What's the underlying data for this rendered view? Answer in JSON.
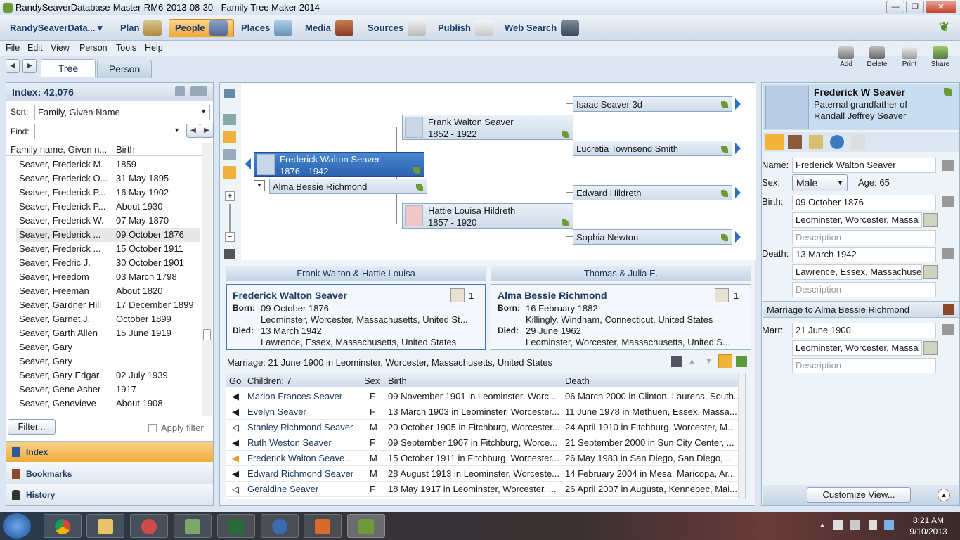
{
  "window": {
    "title": "RandySeaverDatabase-Master-RM6-2013-08-30 - Family Tree Maker 2014",
    "min": "—",
    "max": "❐",
    "close": "✕"
  },
  "nav": {
    "tree_name": "RandySeaverData... ▾",
    "items": [
      "Plan",
      "People",
      "Places",
      "Media",
      "Sources",
      "Publish",
      "Web Search"
    ]
  },
  "menu": [
    "File",
    "Edit",
    "View",
    "Person",
    "Tools",
    "Help"
  ],
  "tabs": {
    "tree": "Tree",
    "person": "Person"
  },
  "toolbar": {
    "add": "Add",
    "delete": "Delete",
    "print": "Print",
    "share": "Share"
  },
  "index": {
    "title": "Index: 42,076",
    "sort_label": "Sort:",
    "sort_value": "Family, Given Name",
    "find_label": "Find:",
    "col_name": "Family name, Given n...",
    "col_birth": "Birth",
    "rows": [
      {
        "name": "Seaver, Frederick M.",
        "birth": "1859"
      },
      {
        "name": "Seaver, Frederick O...",
        "birth": "31 May 1895"
      },
      {
        "name": "Seaver, Frederick P...",
        "birth": "16 May 1902"
      },
      {
        "name": "Seaver, Frederick P...",
        "birth": "About 1930"
      },
      {
        "name": "Seaver, Frederick W.",
        "birth": "07 May 1870"
      },
      {
        "name": "Seaver, Frederick ...",
        "birth": "09 October 1876"
      },
      {
        "name": "Seaver, Frederick ...",
        "birth": "15 October 1911"
      },
      {
        "name": "Seaver, Fredric J.",
        "birth": "30 October 1901"
      },
      {
        "name": "Seaver, Freedom",
        "birth": "03 March 1798"
      },
      {
        "name": "Seaver, Freeman",
        "birth": "About 1820"
      },
      {
        "name": "Seaver, Gardner Hill",
        "birth": "17 December 1899"
      },
      {
        "name": "Seaver, Garnet J.",
        "birth": "October 1899"
      },
      {
        "name": "Seaver, Garth Allen",
        "birth": "15 June 1919"
      },
      {
        "name": "Seaver, Gary",
        "birth": ""
      },
      {
        "name": "Seaver, Gary",
        "birth": ""
      },
      {
        "name": "Seaver, Gary Edgar",
        "birth": "02 July 1939"
      },
      {
        "name": "Seaver, Gene Asher",
        "birth": "1917"
      },
      {
        "name": "Seaver, Genevieve",
        "birth": "About 1908"
      }
    ],
    "filter_btn": "Filter...",
    "apply_filter": "Apply filter"
  },
  "sidebar": [
    "Index",
    "Bookmarks",
    "History"
  ],
  "tree": {
    "root": {
      "name": "Frederick Walton Seaver",
      "dates": "1876 - 1942"
    },
    "spouse": "Alma Bessie Richmond",
    "father": {
      "name": "Frank Walton Seaver",
      "dates": "1852 - 1922"
    },
    "mother": {
      "name": "Hattie Louisa Hildreth",
      "dates": "1857 - 1920"
    },
    "gf1": "Isaac Seaver 3d",
    "gm1": "Lucretia Townsend Smith",
    "gf2": "Edward Hildreth",
    "gm2": "Sophia Newton"
  },
  "family": {
    "parents_left": "Frank Walton & Hattie Louisa",
    "parents_right": "Thomas & Julia E.",
    "husband": {
      "name": "Frederick Walton Seaver",
      "born_label": "Born:",
      "born_date": "09 October 1876",
      "born_place": "Leominster, Worcester, Massachusetts, United St...",
      "died_label": "Died:",
      "died_date": "13 March 1942",
      "died_place": "Lawrence, Essex, Massachusetts, United States",
      "count": "1"
    },
    "wife": {
      "name": "Alma Bessie Richmond",
      "born_label": "Born:",
      "born_date": "16 February 1882",
      "born_place": "Killingly, Windham, Connecticut, United States",
      "died_label": "Died:",
      "died_date": "29 June 1962",
      "died_place": "Leominster, Worcester, Massachusetts, United S...",
      "count": "1"
    },
    "marriage_label": "Marriage:",
    "marriage": "21 June 1900 in Leominster, Worcester, Massachusetts, United States"
  },
  "children": {
    "headers": [
      "Go",
      "Children: 7",
      "Sex",
      "Birth",
      "Death"
    ],
    "rows": [
      {
        "go": "◀",
        "name": "Marion Frances Seaver",
        "sex": "F",
        "birth": "09 November 1901 in Leominster, Worc...",
        "death": "06 March 2000 in Clinton, Laurens, South..."
      },
      {
        "go": "◀",
        "name": "Evelyn Seaver",
        "sex": "F",
        "birth": "13 March 1903 in Leominster, Worcester...",
        "death": "11 June 1978 in Methuen, Essex, Massa..."
      },
      {
        "go": "◁",
        "name": "Stanley Richmond Seaver",
        "sex": "M",
        "birth": "20 October 1905 in Fitchburg, Worcester...",
        "death": "24 April 1910 in Fitchburg, Worcester, M..."
      },
      {
        "go": "◀",
        "name": "Ruth Weston Seaver",
        "sex": "F",
        "birth": "09 September 1907 in Fitchburg, Worce...",
        "death": "21 September 2000 in Sun City Center, ..."
      },
      {
        "go": "◀",
        "name": "Frederick Walton Seave...",
        "sex": "M",
        "birth": "15 October 1911 in Fitchburg, Worcester...",
        "death": "26 May 1983 in San Diego, San Diego, ..."
      },
      {
        "go": "◀",
        "name": "Edward Richmond Seaver",
        "sex": "M",
        "birth": "28 August 1913 in Leominster, Worceste...",
        "death": "14 February 2004 in Mesa, Maricopa, Ar..."
      },
      {
        "go": "◁",
        "name": "Geraldine Seaver",
        "sex": "F",
        "birth": "18 May 1917 in Leominster, Worcester, ...",
        "death": "26 April 2007 in Augusta, Kennebec, Mai..."
      }
    ]
  },
  "details": {
    "name_title": "Frederick W Seaver",
    "relation": "Paternal grandfather of Randall Jeffrey Seaver",
    "name_label": "Name:",
    "name": "Frederick Walton Seaver",
    "sex_label": "Sex:",
    "sex": "Male",
    "age": "Age: 65",
    "birth_label": "Birth:",
    "birth_date": "09 October 1876",
    "birth_place": "Leominster, Worcester, Massa",
    "description": "Description",
    "death_label": "Death:",
    "death_date": "13 March 1942",
    "death_place": "Lawrence, Essex, Massachuse",
    "marriage_title": "Marriage to Alma Bessie Richmond",
    "marr_label": "Marr:",
    "marr_date": "21 June 1900",
    "marr_place": "Leominster, Worcester, Massa",
    "customize": "Customize View..."
  },
  "taskbar": {
    "time": "8:21 AM",
    "date": "9/10/2013"
  }
}
